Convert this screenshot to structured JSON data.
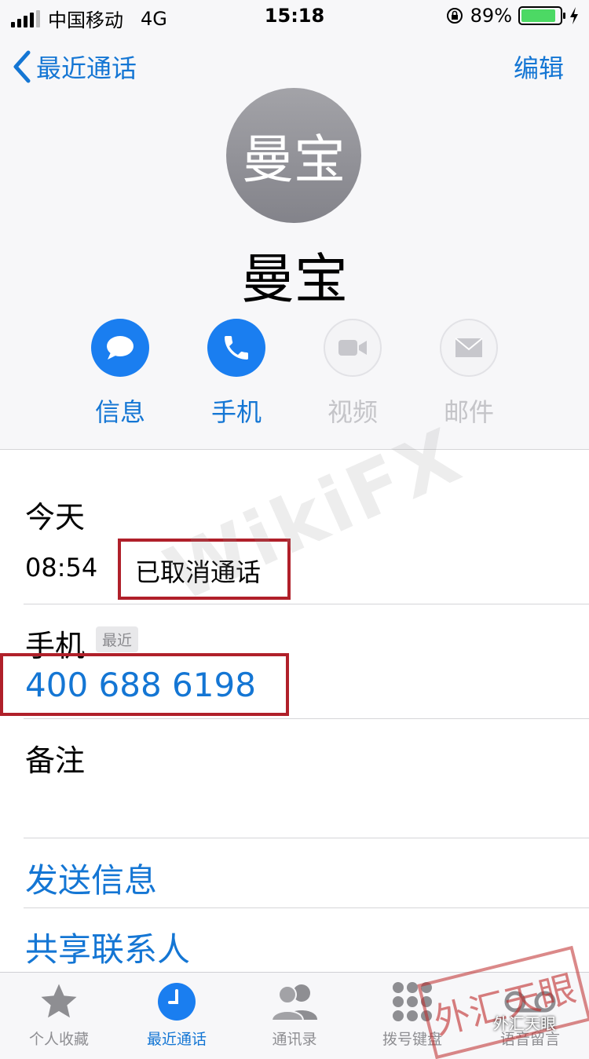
{
  "status_bar": {
    "carrier": "中国移动",
    "network": "4G",
    "time": "15:18",
    "battery_text": "89%",
    "battery_level": 0.89,
    "battery_color": "#4cd964"
  },
  "nav": {
    "back_label": "最近通话",
    "edit_label": "编辑",
    "accent_color": "#1476d4"
  },
  "contact": {
    "avatar_text": "曼宝",
    "name": "曼宝"
  },
  "actions": [
    {
      "label": "信息",
      "icon": "message-bubble-icon",
      "enabled": true
    },
    {
      "label": "手机",
      "icon": "phone-icon",
      "enabled": true
    },
    {
      "label": "视频",
      "icon": "video-camera-icon",
      "enabled": false
    },
    {
      "label": "邮件",
      "icon": "mail-envelope-icon",
      "enabled": false
    }
  ],
  "call_log": {
    "day": "今天",
    "time": "08:54",
    "status": "已取消通话"
  },
  "phone": {
    "label": "手机",
    "tag": "最近",
    "number": "400 688 6198"
  },
  "notes": {
    "label": "备注"
  },
  "links": {
    "send_message": "发送信息",
    "share_contact": "共享联系人"
  },
  "tabs": [
    {
      "label": "个人收藏",
      "icon": "star-icon",
      "active": false
    },
    {
      "label": "最近通话",
      "icon": "clock-icon",
      "active": true
    },
    {
      "label": "通讯录",
      "icon": "contacts-icon",
      "active": false
    },
    {
      "label": "拨号键盘",
      "icon": "keypad-icon",
      "active": false
    },
    {
      "label": "语音留言",
      "icon": "voicemail-icon",
      "active": false
    }
  ],
  "overlays": {
    "watermark": "WikiFX",
    "stamp": "外汇天眼",
    "credit": "外汇天眼"
  }
}
